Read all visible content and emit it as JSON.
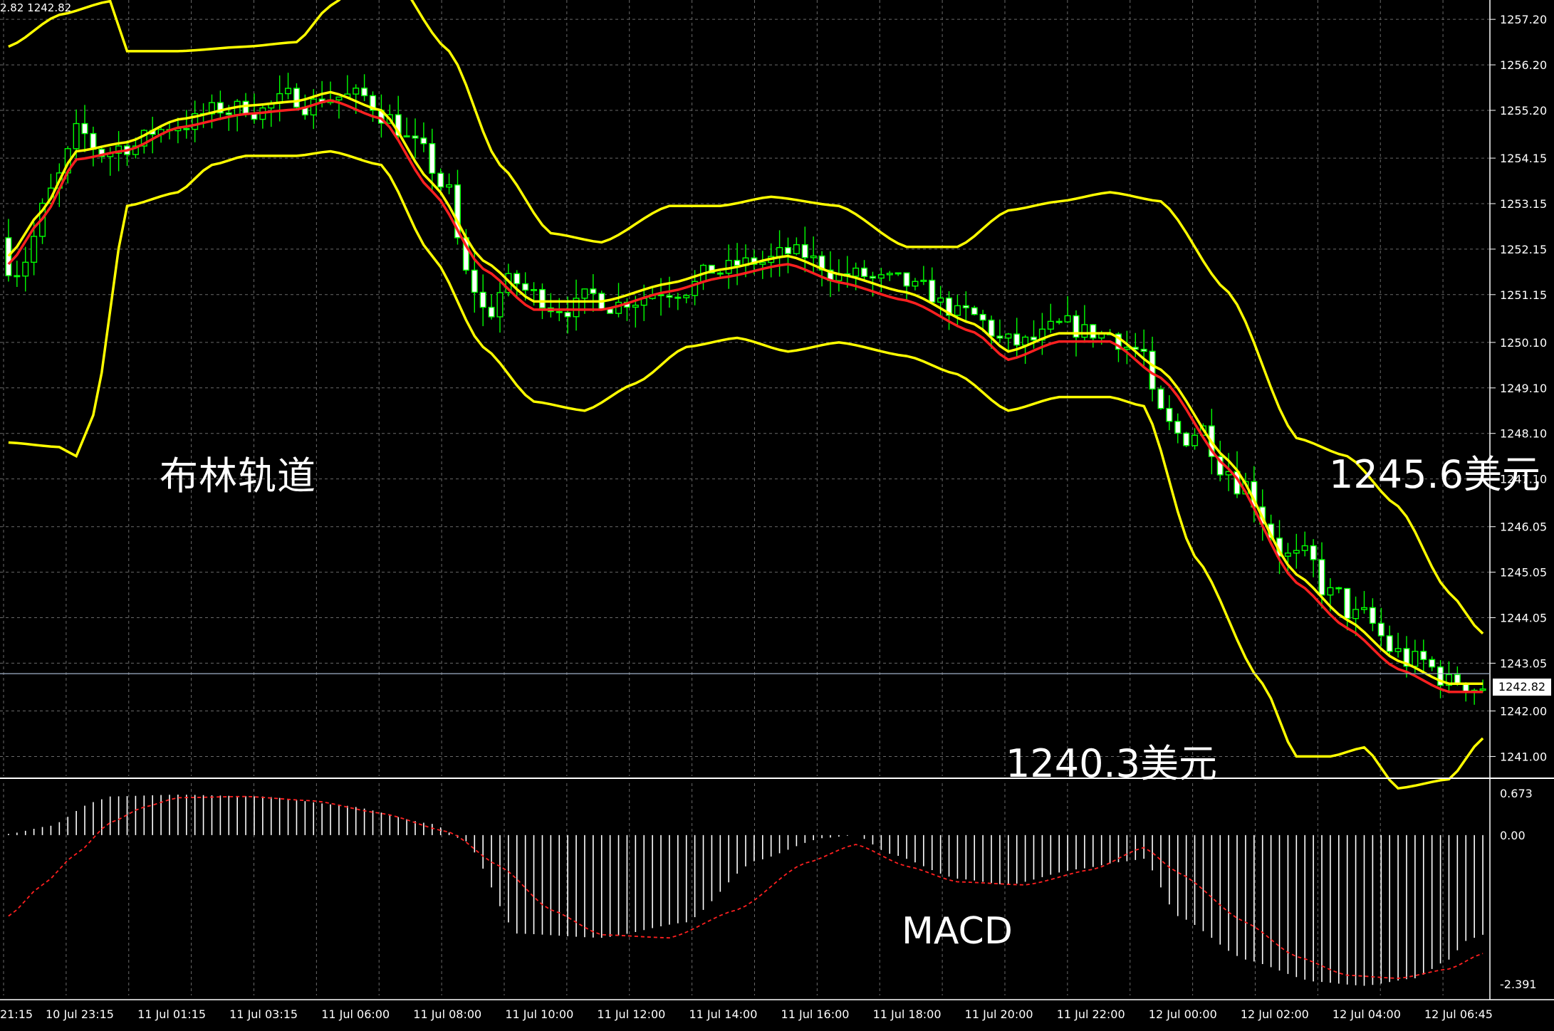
{
  "header": {
    "bid_ask": "2.82 1242.82"
  },
  "annotations": {
    "bollinger_label": "布林轨道",
    "upper_price_label": "1245.6美元",
    "lower_price_label": "1240.3美元",
    "macd_label": "MACD"
  },
  "current_price_label": "1242.82",
  "colors": {
    "background": "#000000",
    "grid": "#6a6a6a",
    "candle": "#00ff00",
    "bollinger": "#ffff00",
    "midline": "#ff2020",
    "macd_hist": "#ffffff",
    "macd_signal": "#ff2020",
    "axis_text": "#ffffff"
  },
  "chart_data": [
    {
      "type": "candlestick",
      "indicator": "Bollinger Bands",
      "price_axis_ticks": [
        "1257.20",
        "1256.20",
        "1255.20",
        "1254.15",
        "1253.15",
        "1252.15",
        "1251.15",
        "1250.10",
        "1249.10",
        "1248.10",
        "1247.10",
        "1246.05",
        "1245.05",
        "1244.05",
        "1243.05",
        "1242.00",
        "1241.00"
      ],
      "ylim": [
        1240.6,
        1257.5
      ],
      "time_axis_labels": [
        "21:15",
        "10 Jul 23:15",
        "11 Jul 01:15",
        "11 Jul 03:15",
        "11 Jul 06:00",
        "11 Jul 08:00",
        "11 Jul 10:00",
        "11 Jul 12:00",
        "11 Jul 14:00",
        "11 Jul 16:00",
        "11 Jul 18:00",
        "11 Jul 20:00",
        "11 Jul 22:00",
        "12 Jul 00:00",
        "12 Jul 02:00",
        "12 Jul 04:00",
        "12 Jul 06:45"
      ],
      "current_price": 1242.82,
      "key_levels": {
        "upper": 1245.6,
        "lower": 1240.3
      },
      "bands": {
        "upper": [
          [
            0,
            1256.6
          ],
          [
            6,
            1257.3
          ],
          [
            12,
            1257.6
          ],
          [
            14,
            1256.5
          ],
          [
            20,
            1256.5
          ],
          [
            28,
            1256.6
          ],
          [
            34,
            1256.7
          ],
          [
            38,
            1257.5
          ],
          [
            44,
            1258.5
          ],
          [
            52,
            1256.5
          ],
          [
            58,
            1254.0
          ],
          [
            64,
            1252.5
          ],
          [
            70,
            1252.3
          ],
          [
            78,
            1253.1
          ],
          [
            84,
            1253.1
          ],
          [
            90,
            1253.3
          ],
          [
            98,
            1253.1
          ],
          [
            106,
            1252.2
          ],
          [
            112,
            1252.2
          ],
          [
            118,
            1253.0
          ],
          [
            124,
            1253.2
          ],
          [
            130,
            1253.4
          ],
          [
            136,
            1253.2
          ],
          [
            144,
            1251.2
          ],
          [
            152,
            1248.0
          ],
          [
            158,
            1247.6
          ],
          [
            164,
            1246.5
          ],
          [
            170,
            1244.6
          ],
          [
            174,
            1243.7
          ]
        ],
        "mid": [
          [
            0,
            1252.0
          ],
          [
            4,
            1253.0
          ],
          [
            8,
            1254.3
          ],
          [
            14,
            1254.5
          ],
          [
            20,
            1255.0
          ],
          [
            28,
            1255.3
          ],
          [
            34,
            1255.4
          ],
          [
            38,
            1255.6
          ],
          [
            44,
            1255.2
          ],
          [
            50,
            1253.6
          ],
          [
            56,
            1251.9
          ],
          [
            62,
            1251.0
          ],
          [
            70,
            1251.0
          ],
          [
            78,
            1251.4
          ],
          [
            84,
            1251.7
          ],
          [
            92,
            1252.0
          ],
          [
            98,
            1251.6
          ],
          [
            106,
            1251.2
          ],
          [
            114,
            1250.5
          ],
          [
            118,
            1249.9
          ],
          [
            124,
            1250.3
          ],
          [
            130,
            1250.3
          ],
          [
            136,
            1249.5
          ],
          [
            144,
            1247.5
          ],
          [
            152,
            1245.0
          ],
          [
            158,
            1244.0
          ],
          [
            164,
            1243.1
          ],
          [
            170,
            1242.6
          ],
          [
            174,
            1242.6
          ]
        ],
        "lower": [
          [
            0,
            1247.9
          ],
          [
            6,
            1247.8
          ],
          [
            8,
            1247.6
          ],
          [
            10,
            1248.5
          ],
          [
            14,
            1253.1
          ],
          [
            20,
            1253.4
          ],
          [
            24,
            1254.0
          ],
          [
            28,
            1254.2
          ],
          [
            34,
            1254.2
          ],
          [
            38,
            1254.3
          ],
          [
            44,
            1254.0
          ],
          [
            50,
            1252.0
          ],
          [
            56,
            1250.0
          ],
          [
            62,
            1248.8
          ],
          [
            68,
            1248.6
          ],
          [
            74,
            1249.2
          ],
          [
            80,
            1250.0
          ],
          [
            86,
            1250.2
          ],
          [
            92,
            1249.9
          ],
          [
            98,
            1250.1
          ],
          [
            106,
            1249.8
          ],
          [
            112,
            1249.4
          ],
          [
            118,
            1248.6
          ],
          [
            124,
            1248.9
          ],
          [
            130,
            1248.9
          ],
          [
            134,
            1248.7
          ],
          [
            140,
            1245.4
          ],
          [
            148,
            1242.6
          ],
          [
            152,
            1241.0
          ],
          [
            156,
            1241.0
          ],
          [
            160,
            1241.2
          ],
          [
            164,
            1240.3
          ],
          [
            170,
            1240.5
          ],
          [
            174,
            1241.4
          ]
        ]
      }
    },
    {
      "type": "bar",
      "indicator": "MACD",
      "axis_ticks": [
        "0.673",
        "0.00",
        "-2.391"
      ],
      "ylim": [
        -2.391,
        0.673
      ],
      "histogram_keypoints": [
        [
          0,
          0.02
        ],
        [
          5,
          0.15
        ],
        [
          10,
          0.53
        ],
        [
          12,
          0.62
        ],
        [
          20,
          0.65
        ],
        [
          30,
          0.62
        ],
        [
          40,
          0.47
        ],
        [
          50,
          0.18
        ],
        [
          54,
          -0.1
        ],
        [
          60,
          -1.58
        ],
        [
          70,
          -1.65
        ],
        [
          80,
          -1.4
        ],
        [
          88,
          -0.42
        ],
        [
          96,
          -0.05
        ],
        [
          100,
          0.0
        ],
        [
          104,
          -0.3
        ],
        [
          112,
          -0.7
        ],
        [
          118,
          -0.8
        ],
        [
          126,
          -0.55
        ],
        [
          132,
          -0.42
        ],
        [
          134,
          -0.38
        ],
        [
          138,
          -1.3
        ],
        [
          146,
          -2.0
        ],
        [
          154,
          -2.35
        ],
        [
          160,
          -2.42
        ],
        [
          166,
          -2.3
        ],
        [
          170,
          -2.0
        ],
        [
          172,
          -1.7
        ],
        [
          174,
          -1.6
        ]
      ],
      "signal_keypoints": [
        [
          0,
          -1.3
        ],
        [
          4,
          -0.8
        ],
        [
          8,
          -0.3
        ],
        [
          12,
          0.2
        ],
        [
          16,
          0.45
        ],
        [
          20,
          0.6
        ],
        [
          28,
          0.62
        ],
        [
          36,
          0.55
        ],
        [
          44,
          0.35
        ],
        [
          52,
          0.05
        ],
        [
          58,
          -0.5
        ],
        [
          64,
          -1.2
        ],
        [
          70,
          -1.6
        ],
        [
          78,
          -1.65
        ],
        [
          86,
          -1.2
        ],
        [
          94,
          -0.45
        ],
        [
          100,
          -0.15
        ],
        [
          106,
          -0.5
        ],
        [
          112,
          -0.75
        ],
        [
          120,
          -0.8
        ],
        [
          128,
          -0.55
        ],
        [
          134,
          -0.2
        ],
        [
          138,
          -0.6
        ],
        [
          146,
          -1.4
        ],
        [
          152,
          -1.95
        ],
        [
          158,
          -2.25
        ],
        [
          164,
          -2.3
        ],
        [
          170,
          -2.15
        ],
        [
          174,
          -1.9
        ]
      ]
    }
  ]
}
